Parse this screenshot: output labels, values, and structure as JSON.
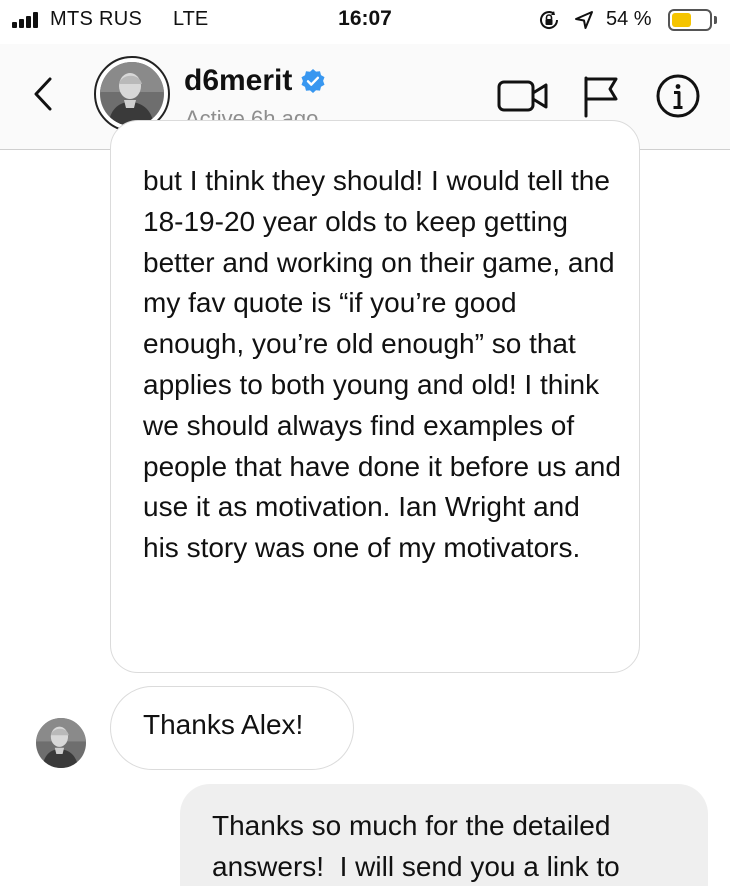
{
  "status_bar": {
    "carrier": "MTS RUS",
    "network": "LTE",
    "time": "16:07",
    "battery_percent": "54 %",
    "battery_level": 0.54,
    "icons": [
      "signal-bars-icon",
      "rotation-lock-icon",
      "location-arrow-icon",
      "battery-icon"
    ]
  },
  "header": {
    "username": "d6merit",
    "verified": true,
    "status": "Active 6h ago",
    "icons": [
      "back-chevron-icon",
      "video-call-icon",
      "flag-icon",
      "info-icon"
    ]
  },
  "messages": [
    {
      "direction": "incoming",
      "text": "but I think they should! I would tell the 18-19-20 year olds to keep getting better and working on their game, and my fav quote is “if you’re good enough, you’re old enough” so that applies to both young and old! I think we should always find examples of people that have done it before us and use it as motivation. Ian Wright and his story was one of my motivators."
    },
    {
      "direction": "incoming",
      "text": "Thanks Alex!"
    },
    {
      "direction": "outgoing",
      "text": "Thanks so much for the detailed answers!  I will send you a link to"
    }
  ],
  "colors": {
    "verified_blue": "#3897f0",
    "secondary_text": "#8e8e8e",
    "bubble_border": "#dbdbdb",
    "outgoing_bubble": "#efefef",
    "battery_fill": "#f5c400"
  }
}
